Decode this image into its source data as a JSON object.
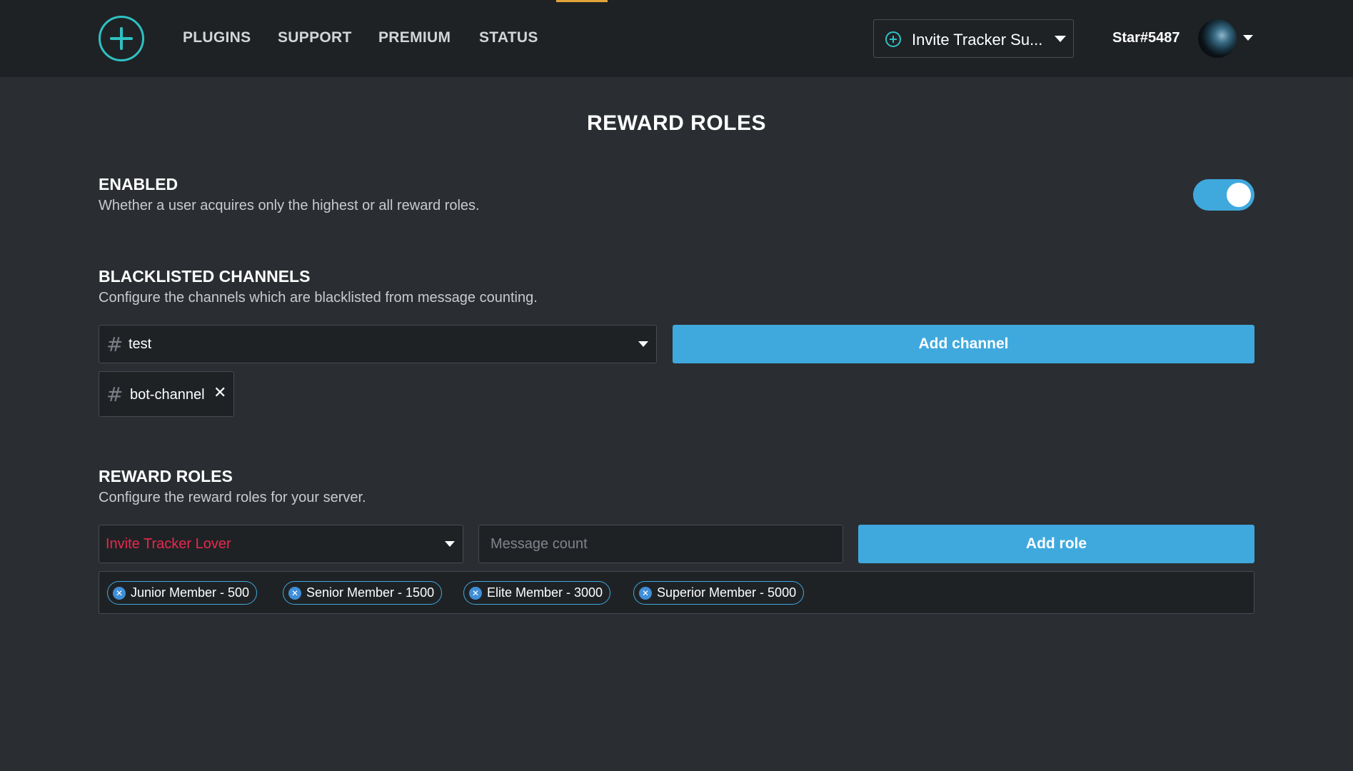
{
  "nav": {
    "links": [
      "PLUGINS",
      "SUPPORT",
      "PREMIUM",
      "STATUS"
    ],
    "server_name": "Invite Tracker Su...",
    "username": "Star#5487"
  },
  "page": {
    "title": "REWARD ROLES"
  },
  "enabled": {
    "title": "ENABLED",
    "description": "Whether a user acquires only the highest or all reward roles.",
    "toggle_on": true
  },
  "blacklisted": {
    "title": "BLACKLISTED CHANNELS",
    "description": "Configure the channels which are blacklisted from message counting.",
    "selected_channel": "test",
    "add_button": "Add channel",
    "channels": [
      "bot-channel"
    ]
  },
  "reward_roles": {
    "title": "REWARD ROLES",
    "description": "Configure the reward roles for your server.",
    "selected_role": "Invite Tracker Lover",
    "selected_role_color": "#e8294f",
    "message_count_placeholder": "Message count",
    "add_button": "Add role",
    "roles": [
      "Junior Member - 500",
      "Senior Member - 1500",
      "Elite Member - 3000",
      "Superior Member - 5000"
    ]
  },
  "colors": {
    "accent": "#3fa9de",
    "logo": "#2fc1c3",
    "nav_active": "#e0a43a"
  }
}
